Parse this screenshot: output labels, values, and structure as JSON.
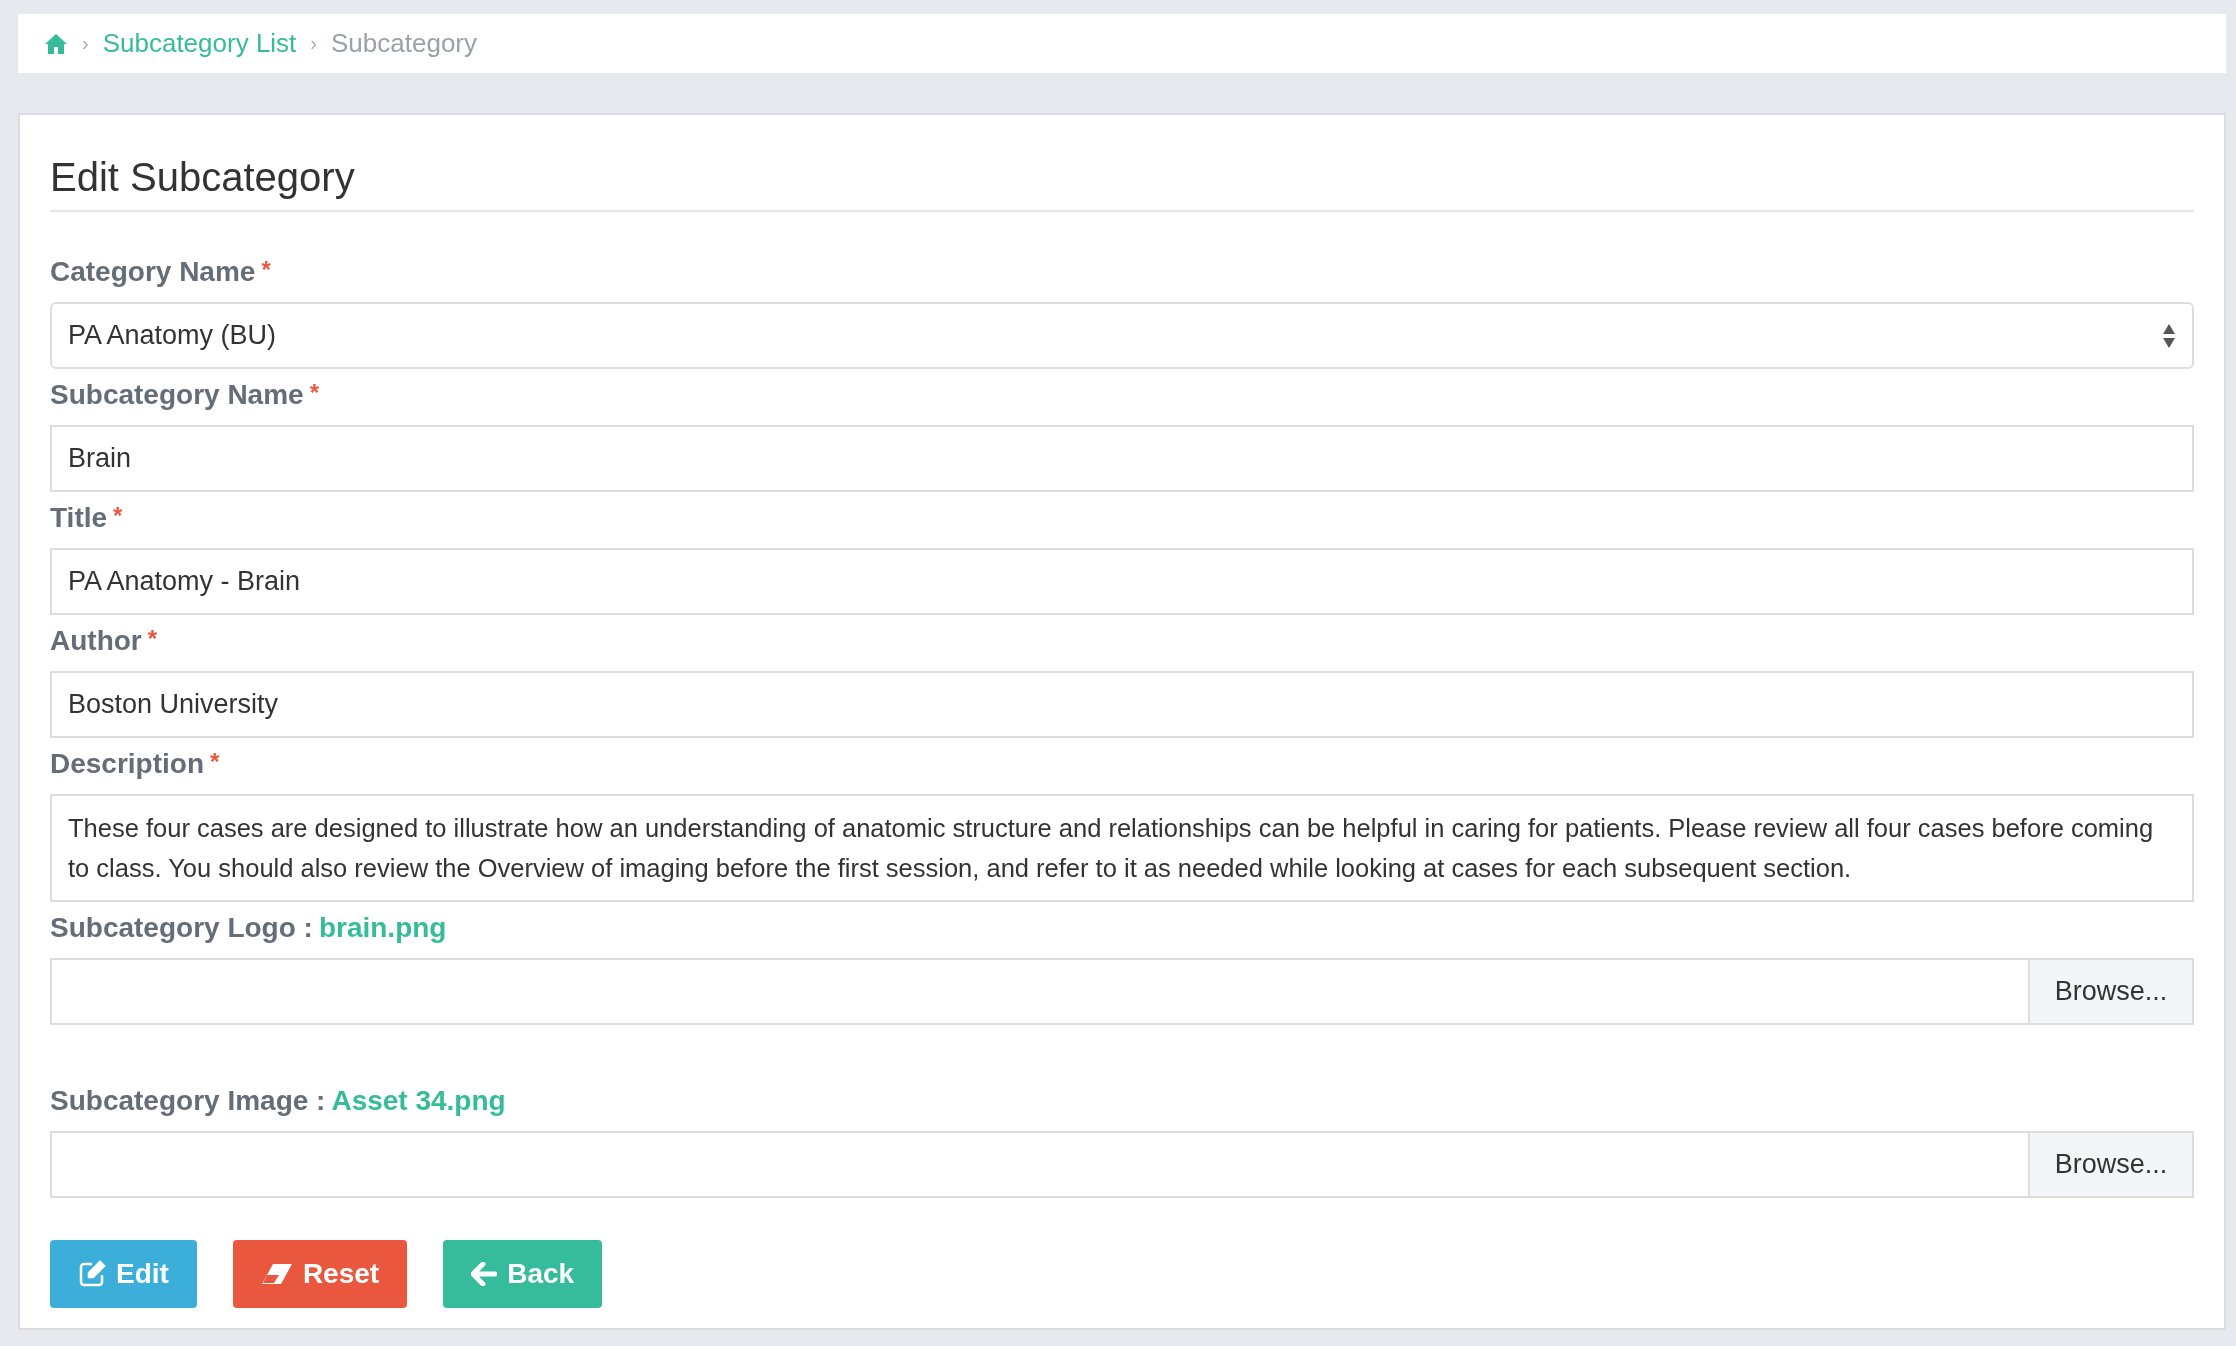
{
  "breadcrumb": {
    "items": [
      {
        "separator": "›",
        "label": "Subcategory List",
        "kind": "link"
      },
      {
        "separator": "›",
        "label": "Subcategory",
        "kind": "current"
      }
    ]
  },
  "form": {
    "title": "Edit Subcategory",
    "fields": [
      {
        "kind": "select",
        "label": "Category Name",
        "required_mark": "*",
        "value": "PA Anatomy (BU)"
      },
      {
        "kind": "text",
        "label": "Subcategory Name",
        "required_mark": "*",
        "value": "Brain"
      },
      {
        "kind": "text",
        "label": "Title",
        "required_mark": "*",
        "value": "PA Anatomy - Brain"
      },
      {
        "kind": "text",
        "label": "Author",
        "required_mark": "*",
        "value": "Boston University"
      },
      {
        "kind": "textarea",
        "label": "Description",
        "required_mark": "*",
        "value": "These four cases are designed to illustrate how an understanding of anatomic structure and relationships can be helpful in caring for patients. Please review all four cases before coming to class. You should also review the Overview of imaging before the first session, and refer to it as needed while looking at cases for each subsequent section."
      },
      {
        "kind": "file",
        "label": "Subcategory Logo :",
        "file": "brain.png",
        "button": "Browse..."
      },
      {
        "kind": "file",
        "label": "Subcategory Image :",
        "file": "Asset 34.png",
        "button": "Browse..."
      }
    ],
    "buttons": [
      {
        "kind": "edit",
        "label": "Edit"
      },
      {
        "kind": "reset",
        "label": "Reset"
      },
      {
        "kind": "back",
        "label": "Back"
      }
    ]
  }
}
